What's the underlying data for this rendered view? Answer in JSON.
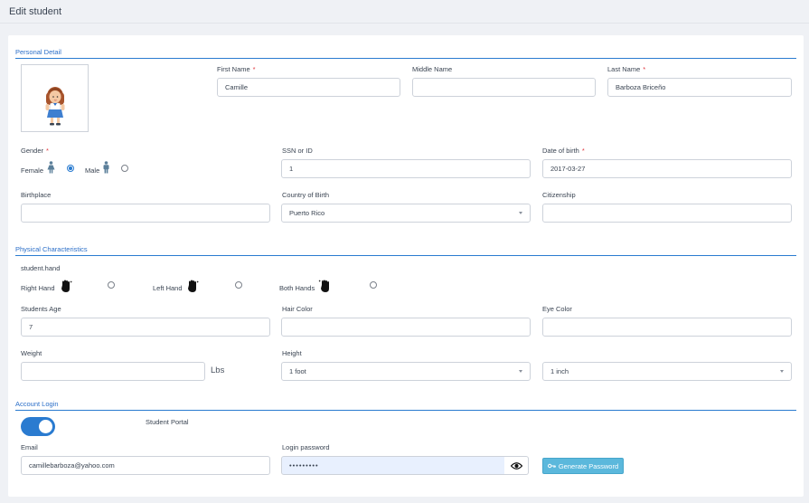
{
  "page": {
    "title": "Edit student"
  },
  "sections": {
    "personal": "Personal Detail",
    "physical": "Physical Characteristics",
    "account": "Account Login"
  },
  "personal": {
    "first_name": {
      "label": "First Name",
      "required": "*",
      "value": "Camille"
    },
    "middle_name": {
      "label": "Middle Name",
      "value": ""
    },
    "last_name": {
      "label": "Last Name",
      "required": "*",
      "value": "Barboza Briceño"
    },
    "gender": {
      "label": "Gender",
      "required": "*",
      "options": [
        {
          "label": "Female",
          "icon": "female-icon",
          "selected": true
        },
        {
          "label": "Male",
          "icon": "male-icon",
          "selected": false
        }
      ]
    },
    "ssn": {
      "label": "SSN or ID",
      "value": "1"
    },
    "dob": {
      "label": "Date of birth",
      "required": "*",
      "value": "2017-03-27"
    },
    "birthplace": {
      "label": "Birthplace",
      "value": ""
    },
    "country_of_birth": {
      "label": "Country of Birth",
      "value": "Puerto Rico"
    },
    "citizenship": {
      "label": "Citizenship",
      "value": ""
    }
  },
  "physical": {
    "hand_label": "student.hand",
    "hands": [
      {
        "label": "Right Hand",
        "icon": "right-hand-icon"
      },
      {
        "label": "Left Hand",
        "icon": "left-hand-icon"
      },
      {
        "label": "Both Hands",
        "icon": "both-hands-icon"
      }
    ],
    "age": {
      "label": "Students Age",
      "value": "7"
    },
    "hair_color": {
      "label": "Hair Color",
      "value": ""
    },
    "eye_color": {
      "label": "Eye Color",
      "value": ""
    },
    "weight": {
      "label": "Weight",
      "value": "",
      "unit": "Lbs"
    },
    "height": {
      "label": "Height",
      "feet": "1 foot",
      "inches": "1 inch"
    }
  },
  "account": {
    "portal_label": "Student Portal",
    "portal_enabled": true,
    "email": {
      "label": "Email",
      "value": "camillebarboza@yahoo.com"
    },
    "password": {
      "label": "Login password",
      "value": "•••••••••"
    },
    "generate_label": "Generate Password"
  },
  "colors": {
    "accent": "#2a7bd0",
    "required": "#e0363d",
    "generate_button": "#5bb8dc",
    "autofill": "#e8f0fe"
  }
}
